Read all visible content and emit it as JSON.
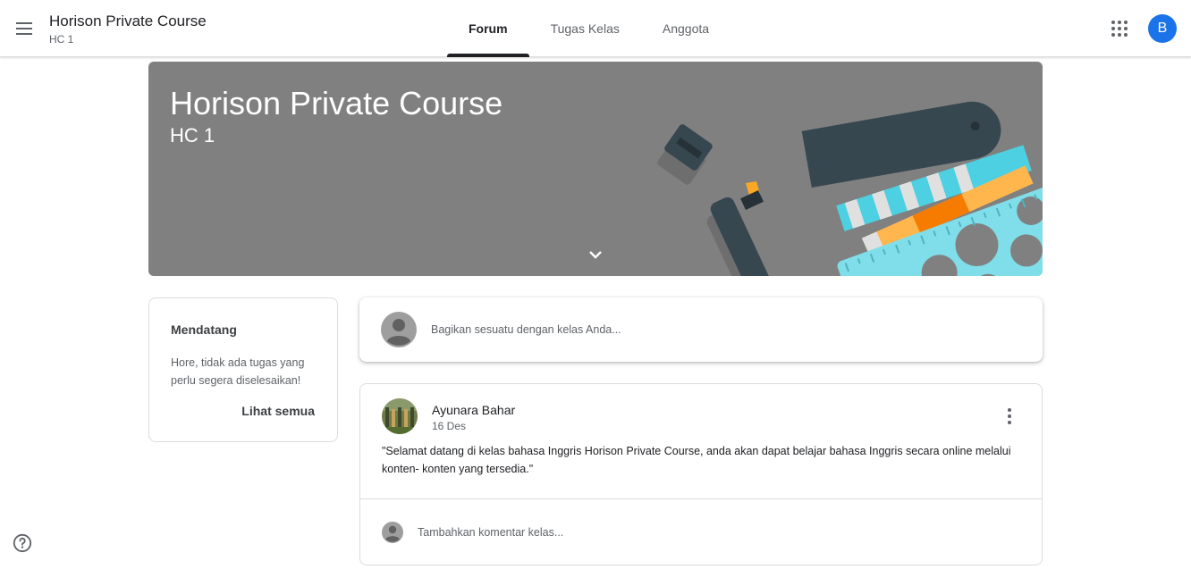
{
  "header": {
    "class_name": "Horison Private Course",
    "class_section": "HC 1",
    "tabs": [
      {
        "label": "Forum",
        "active": true
      },
      {
        "label": "Tugas Kelas",
        "active": false
      },
      {
        "label": "Anggota",
        "active": false
      }
    ],
    "avatar_initial": "B",
    "avatar_color": "#1a73e8",
    "icons": [
      "menu-icon",
      "apps-grid-icon"
    ]
  },
  "banner": {
    "title": "Horison Private Course",
    "subtitle": "HC 1",
    "background_color": "#808080",
    "icons": [
      "chevron-down-icon"
    ]
  },
  "upcoming": {
    "title": "Mendatang",
    "text": "Hore, tidak ada tugas yang perlu segera diselesaikan!",
    "link_label": "Lihat semua"
  },
  "share": {
    "placeholder": "Bagikan sesuatu dengan kelas Anda..."
  },
  "post": {
    "author": "Ayunara Bahar",
    "date": "16 Des",
    "body": "\"Selamat datang di kelas bahasa Inggris Horison Private Course, anda akan dapat belajar bahasa Inggris secara online melalui konten- konten yang tersedia.\"",
    "comment_placeholder": "Tambahkan komentar kelas...",
    "icons": [
      "more-vert-icon"
    ]
  },
  "footer": {
    "icons": [
      "help-icon"
    ]
  }
}
